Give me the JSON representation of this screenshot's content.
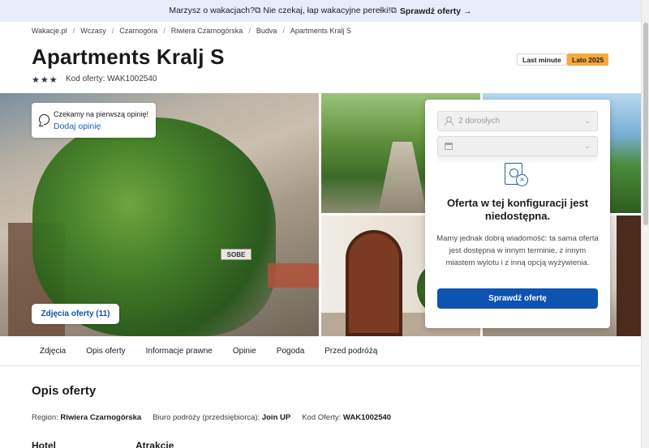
{
  "promo": {
    "text": "Marzysz o wakacjach?⧉ Nie czekaj, łap wakacyjne perełki!⧉",
    "cta": "Sprawdź oferty",
    "arrow": "→"
  },
  "breadcrumb": [
    "Wakacje.pl",
    "Wczasy",
    "Czarnogóra",
    "Riwiera Czarnogórska",
    "Budva",
    "Apartments Kralj S"
  ],
  "breadcrumb_sep": "/",
  "hotel": {
    "title": "Apartments Kralj S",
    "stars": 3,
    "code_label": "Kod oferty: WAK1002540"
  },
  "tags": {
    "last_minute": "Last minute",
    "season": "Lato 2025"
  },
  "review": {
    "text": "Czekamy na pierwszą opinię!",
    "link": "Dodaj opinię"
  },
  "gallery": {
    "photos_button": "Zdjęcia oferty (11)",
    "sign_text": "SOBE"
  },
  "booking": {
    "guests": "2 dorosłych",
    "date": "",
    "unavailable_title": "Oferta w tej konfiguracji jest niedostępna.",
    "unavailable_msg": "Mamy jednak dobrą wiadomość: ta sama oferta jest dostępna w innym terminie, z innym miastem wylotu i z inną opcją wyżywienia.",
    "check_button": "Sprawdź ofertę"
  },
  "tabs": [
    "Zdjęcia",
    "Opis oferty",
    "Informacje prawne",
    "Opinie",
    "Pogoda",
    "Przed podróżą"
  ],
  "description": {
    "title": "Opis oferty",
    "region_label": "Region:",
    "region_value": "Riwiera Czarnogórska",
    "agency_label": "Biuro podróży (przedsiębiorca):",
    "agency_value": "Join UP",
    "code_label": "Kod Oferty:",
    "code_value": "WAK1002540"
  },
  "bottom": {
    "hotel": "Hotel",
    "attractions": "Atrakcje"
  },
  "colors": {
    "primary": "#0d53b0",
    "season_tag": "#f7a93b",
    "promo_bg": "#e7eefb"
  },
  "icons": {
    "stars": "star-icon",
    "review": "chat-bubble-icon",
    "guests": "person-icon",
    "date": "calendar-icon",
    "unavailable": "document-x-icon"
  }
}
